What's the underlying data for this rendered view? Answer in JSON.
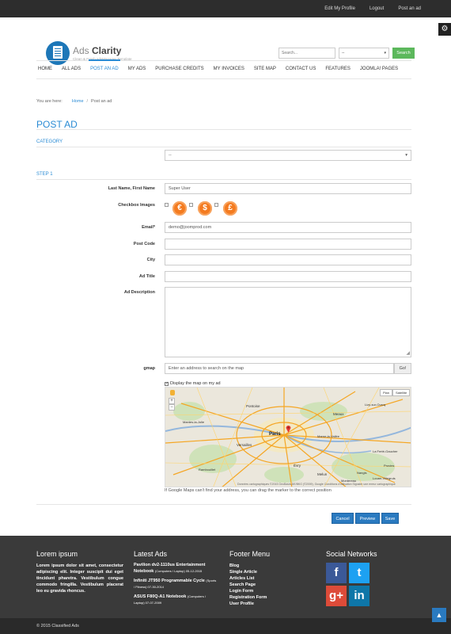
{
  "topbar": {
    "links": [
      "Edit My Profile",
      "Logout",
      "Post an ad"
    ]
  },
  "logo": {
    "title_a": "Ads ",
    "title_b": "Clarity",
    "subtitle": "Clean & Fresh adsManager Template"
  },
  "search": {
    "placeholder": "Search...",
    "category": "--",
    "button": "Search"
  },
  "nav": {
    "items": [
      "HOME",
      "ALL ADS",
      "POST AN AD",
      "MY ADS",
      "PURCHASE CREDITS",
      "MY INVOICES",
      "SITE MAP",
      "CONTACT US",
      "FEATURES",
      "JOOMLA! PAGES"
    ],
    "active": "POST AN AD"
  },
  "breadcrumb": {
    "prefix": "You are here:",
    "home": "Home",
    "current": "Post an ad"
  },
  "page": {
    "title": "POST AD",
    "category_section": "CATEGORY",
    "category_value": "--",
    "step_section": "STEP 1"
  },
  "form": {
    "name_label": "Last Name, First Name",
    "name_value": "Super User",
    "checkbox_label": "Checkbox Images",
    "coins": [
      "€",
      "$",
      "£"
    ],
    "email_label": "Email*",
    "email_value": "demo@joomprod.com",
    "postcode_label": "Post Code",
    "city_label": "City",
    "adtitle_label": "Ad Title",
    "description_label": "Ad Description",
    "gmap_label": "gmap",
    "gmap_placeholder": "Enter an address to search on the map",
    "gmap_button": "Go!",
    "map_check": "Display the map on my ad",
    "map_types": [
      "Plan",
      "Satellite"
    ],
    "map_footer": "Données cartographiques ©2015 GeoBasis-DE/BKG (©2009), Google   Conditions d'utilisation   Signaler une erreur cartographique",
    "map_hint": "If Google Maps can't find your address, you can drag the marker to the correct position",
    "map_labels": [
      "Paris",
      "Versailles",
      "Meaux",
      "Évry",
      "Melun",
      "Marne-la-Vallée",
      "Pontoise",
      "Mantes-la-Jolie",
      "Rambouillet",
      "Provins",
      "Lizy-sur-Ourcq",
      "La Ferté-Gaucher",
      "Nangis",
      "Montereau",
      "Louan-Villegruis"
    ]
  },
  "actions": {
    "cancel": "Cancel",
    "preview": "Preview",
    "save": "Save"
  },
  "footer": {
    "col1_title": "Lorem ipsum",
    "col1_text": "Lorem ipsum dolor sit amet, consectetur adipiscing elit. Integer suscipit dui eget tincidunt pharetra. Vestibulum congue commodo fringilla. Vestibulum placerat leo eu gravida rhoncus.",
    "col2_title": "Latest Ads",
    "ads": [
      {
        "title": "Pavilion dv2-1110us Entertainment Notebook",
        "meta": "(Computers / Laptop) 05-12-2015"
      },
      {
        "title": "Infiniti JT950 Programmable Cycle",
        "meta": "(Sports / Fitness) 07-30-2014"
      },
      {
        "title": "ASUS F80Q-A1 Notebook",
        "meta": "(Computers / Laptop) 07-07-2009"
      }
    ],
    "col3_title": "Footer Menu",
    "menu": [
      "Blog",
      "Single Article",
      "Articles List",
      "Search Page",
      "Login Form",
      "Registration Form",
      "User Profile"
    ],
    "col4_title": "Social Networks",
    "social": [
      {
        "name": "facebook",
        "glyph": "f",
        "color": "#3b5998"
      },
      {
        "name": "twitter",
        "glyph": "t",
        "color": "#1da1f2"
      },
      {
        "name": "google-plus",
        "glyph": "g+",
        "color": "#dd4b39"
      },
      {
        "name": "linkedin",
        "glyph": "in",
        "color": "#0e76a8"
      }
    ],
    "copyright": "© 2015 Classified Ads"
  }
}
